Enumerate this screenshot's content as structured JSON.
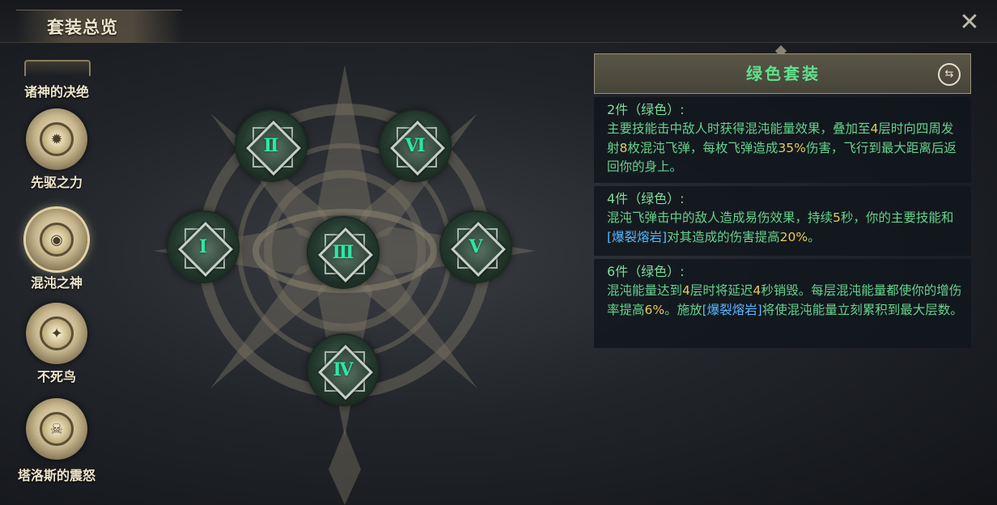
{
  "header": {
    "title": "套装总览"
  },
  "sidebar": {
    "items": [
      {
        "label": "诸神的决绝",
        "icon": "sword-icon"
      },
      {
        "label": "先驱之力",
        "icon": "sun-emblem-icon"
      },
      {
        "label": "混沌之神",
        "icon": "eye-emblem-icon",
        "active": true
      },
      {
        "label": "不死鸟",
        "icon": "phoenix-emblem-icon"
      },
      {
        "label": "塔洛斯的震怒",
        "icon": "skull-emblem-icon"
      }
    ]
  },
  "emblem": {
    "nodes": [
      {
        "numeral": "Ⅱ"
      },
      {
        "numeral": "Ⅵ"
      },
      {
        "numeral": "Ⅰ"
      },
      {
        "numeral": "Ⅲ"
      },
      {
        "numeral": "Ⅴ"
      },
      {
        "numeral": "Ⅳ"
      }
    ]
  },
  "set_panel": {
    "title": "绿色套装",
    "bonuses": [
      {
        "header": "2件（绿色）:",
        "segments": [
          {
            "t": "主要技能击中敌人时获得混沌能量效果，叠加至"
          },
          {
            "t": "4",
            "c": "hl"
          },
          {
            "t": "层时向四周发射"
          },
          {
            "t": "8",
            "c": "hl"
          },
          {
            "t": "枚混沌飞弹，每枚飞弹造成"
          },
          {
            "t": "35%",
            "c": "hl"
          },
          {
            "t": "伤害，飞行到最大距离后返回你的身上。"
          }
        ]
      },
      {
        "header": "4件（绿色）:",
        "segments": [
          {
            "t": "混沌飞弹击中的敌人造成易伤效果，持续"
          },
          {
            "t": "5",
            "c": "hl"
          },
          {
            "t": "秒，你的主要技能和"
          },
          {
            "t": "[爆裂熔岩]",
            "c": "kw"
          },
          {
            "t": "对其造成的伤害提高"
          },
          {
            "t": "20%",
            "c": "hl"
          },
          {
            "t": "。"
          }
        ]
      },
      {
        "header": "6件（绿色）:",
        "segments": [
          {
            "t": "混沌能量达到"
          },
          {
            "t": "4",
            "c": "hl"
          },
          {
            "t": "层时将延迟"
          },
          {
            "t": "4",
            "c": "hl"
          },
          {
            "t": "秒销毁。每层混沌能量都使你的增伤率提高"
          },
          {
            "t": "6%",
            "c": "hl"
          },
          {
            "t": "。施放"
          },
          {
            "t": "[爆裂熔岩]",
            "c": "kw"
          },
          {
            "t": "将使混沌能量立刻累积到最大层数。"
          }
        ]
      }
    ]
  }
}
